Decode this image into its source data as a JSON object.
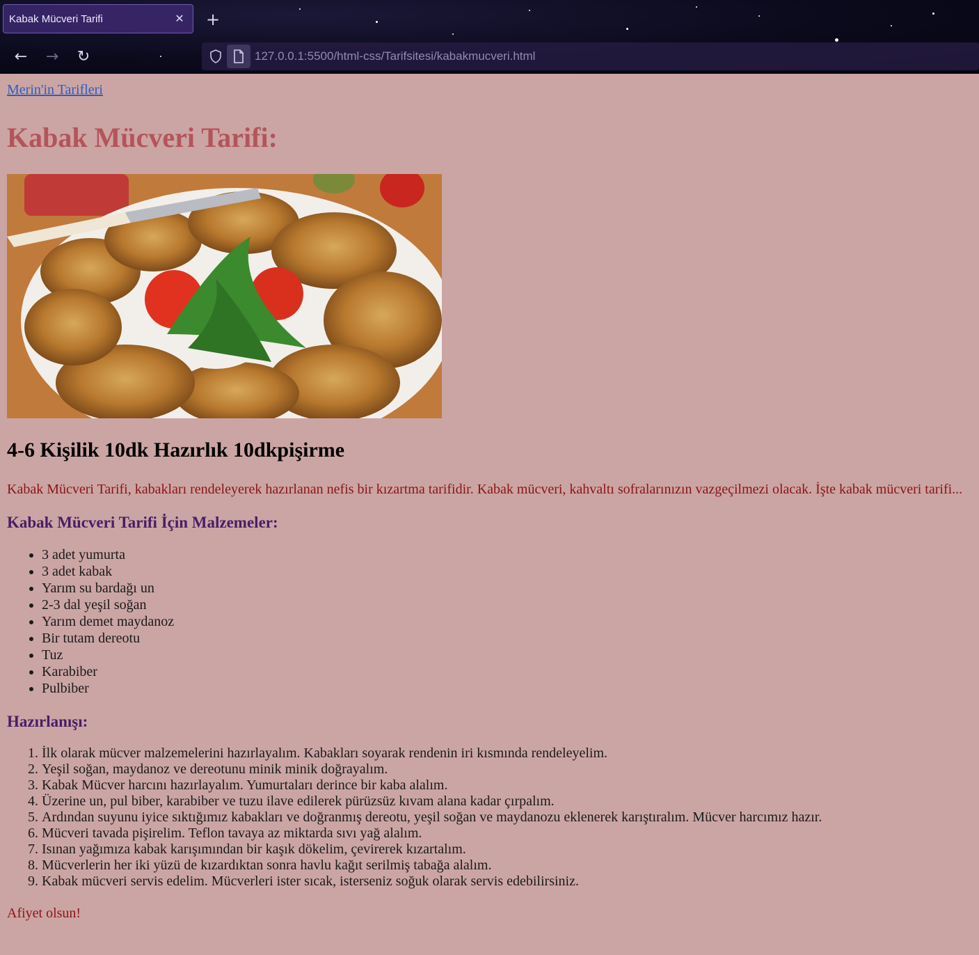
{
  "browser": {
    "tab_title": "Kabak Mücveri Tarifi",
    "tab_close": "✕",
    "new_tab": "+",
    "url": "127.0.0.1:5500/html-css/Tarifsitesi/kabakmucveri.html",
    "back_icon": "←",
    "forward_icon": "→",
    "reload_icon": "↻"
  },
  "page": {
    "home_link": "Merin'in Tarifleri",
    "title": "Kabak Mücveri Tarifi:",
    "servings": "4-6 Kişilik 10dk Hazırlık 10dkpişirme",
    "intro": "Kabak Mücveri Tarifi, kabakları rendeleyerek hazırlanan nefis bir kızartma tarifidir. Kabak mücveri, kahvaltı sofralarınızın vazgeçilmezi olacak. İşte kabak mücveri tarifi...",
    "ingredients_heading": "Kabak Mücveri Tarifi İçin Malzemeler:",
    "ingredients": [
      "3 adet yumurta",
      "3 adet kabak",
      "Yarım su bardağı un",
      "2-3 dal yeşil soğan",
      "Yarım demet maydanoz",
      "Bir tutam dereotu",
      "Tuz",
      "Karabiber",
      "Pulbiber"
    ],
    "preparation_heading": "Hazırlanışı:",
    "steps": [
      "İlk olarak mücver malzemelerini hazırlayalım. Kabakları soyarak rendenin iri kısmında rendeleyelim.",
      "Yeşil soğan, maydanoz ve dereotunu minik minik doğrayalım.",
      "Kabak Mücver harcını hazırlayalım. Yumurtaları derince bir kaba alalım.",
      "Üzerine un, pul biber, karabiber ve tuzu ilave edilerek pürüzsüz kıvam alana kadar çırpalım.",
      "Ardından suyunu iyice sıktığımız kabakları ve doğranmış dereotu, yeşil soğan ve maydanozu eklenerek karıştıralım. Mücver harcımız hazır.",
      "Mücveri tavada pişirelim. Teflon tavaya az miktarda sıvı yağ alalım.",
      "Isınan yağımıza kabak karışımından bir kaşık dökelim, çevirerek kızartalım.",
      "Mücverlerin her iki yüzü de kızardıktan sonra havlu kağıt serilmiş tabağa alalım.",
      "Kabak mücveri servis edelim. Mücverleri ister sıcak, isterseniz soğuk olarak servis edebilirsiniz."
    ],
    "closing": "Afiyet olsun!"
  },
  "colors": {
    "page_background": "#cba5a4",
    "title": "#b4545a",
    "intro_text": "#8b1414",
    "subheading": "#4a1d66",
    "link": "#2e5cc2"
  }
}
